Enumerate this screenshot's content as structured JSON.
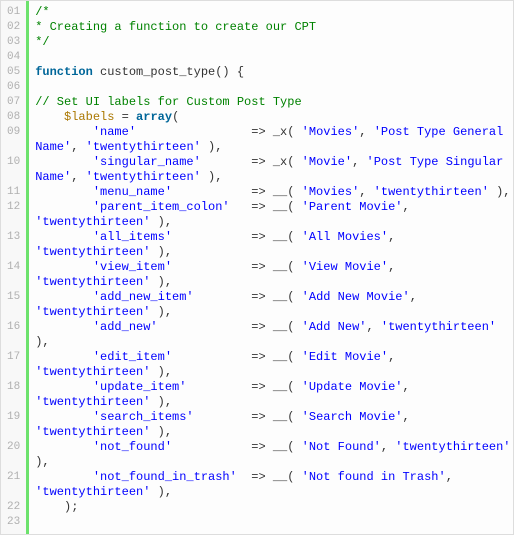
{
  "lines": [
    {
      "num": "01",
      "segs": [
        {
          "cls": "c-comment",
          "t": "/*"
        }
      ]
    },
    {
      "num": "02",
      "segs": [
        {
          "cls": "c-comment",
          "t": "* Creating a function to create our CPT"
        }
      ]
    },
    {
      "num": "03",
      "segs": [
        {
          "cls": "c-comment",
          "t": "*/"
        }
      ]
    },
    {
      "num": "04",
      "segs": [
        {
          "cls": "c-plain",
          "t": " "
        }
      ]
    },
    {
      "num": "05",
      "segs": [
        {
          "cls": "c-keyword",
          "t": "function"
        },
        {
          "cls": "c-plain",
          "t": " custom_post_type() {"
        }
      ]
    },
    {
      "num": "06",
      "segs": [
        {
          "cls": "c-plain",
          "t": " "
        }
      ]
    },
    {
      "num": "07",
      "segs": [
        {
          "cls": "c-comment",
          "t": "// Set UI labels for Custom Post Type"
        }
      ]
    },
    {
      "num": "08",
      "segs": [
        {
          "cls": "c-plain",
          "t": "    "
        },
        {
          "cls": "c-var",
          "t": "$labels"
        },
        {
          "cls": "c-plain",
          "t": " = "
        },
        {
          "cls": "c-keyword",
          "t": "array"
        },
        {
          "cls": "c-plain",
          "t": "("
        }
      ]
    },
    {
      "num": "09",
      "segs": [
        {
          "cls": "c-plain",
          "t": "        "
        },
        {
          "cls": "c-string",
          "t": "'name'"
        },
        {
          "cls": "c-plain",
          "t": "                => _x( "
        },
        {
          "cls": "c-string",
          "t": "'Movies'"
        },
        {
          "cls": "c-plain",
          "t": ", "
        },
        {
          "cls": "c-string",
          "t": "'Post Type General Name'"
        },
        {
          "cls": "c-plain",
          "t": ", "
        },
        {
          "cls": "c-string",
          "t": "'twentythirteen'"
        },
        {
          "cls": "c-plain",
          "t": " ),"
        }
      ]
    },
    {
      "num": "10",
      "segs": [
        {
          "cls": "c-plain",
          "t": "        "
        },
        {
          "cls": "c-string",
          "t": "'singular_name'"
        },
        {
          "cls": "c-plain",
          "t": "       => _x( "
        },
        {
          "cls": "c-string",
          "t": "'Movie'"
        },
        {
          "cls": "c-plain",
          "t": ", "
        },
        {
          "cls": "c-string",
          "t": "'Post Type Singular Name'"
        },
        {
          "cls": "c-plain",
          "t": ", "
        },
        {
          "cls": "c-string",
          "t": "'twentythirteen'"
        },
        {
          "cls": "c-plain",
          "t": " ),"
        }
      ]
    },
    {
      "num": "11",
      "segs": [
        {
          "cls": "c-plain",
          "t": "        "
        },
        {
          "cls": "c-string",
          "t": "'menu_name'"
        },
        {
          "cls": "c-plain",
          "t": "           => __( "
        },
        {
          "cls": "c-string",
          "t": "'Movies'"
        },
        {
          "cls": "c-plain",
          "t": ", "
        },
        {
          "cls": "c-string",
          "t": "'twentythirteen'"
        },
        {
          "cls": "c-plain",
          "t": " ),"
        }
      ]
    },
    {
      "num": "12",
      "segs": [
        {
          "cls": "c-plain",
          "t": "        "
        },
        {
          "cls": "c-string",
          "t": "'parent_item_colon'"
        },
        {
          "cls": "c-plain",
          "t": "   => __( "
        },
        {
          "cls": "c-string",
          "t": "'Parent Movie'"
        },
        {
          "cls": "c-plain",
          "t": ", "
        },
        {
          "cls": "c-string",
          "t": "'twentythirteen'"
        },
        {
          "cls": "c-plain",
          "t": " ),"
        }
      ]
    },
    {
      "num": "13",
      "segs": [
        {
          "cls": "c-plain",
          "t": "        "
        },
        {
          "cls": "c-string",
          "t": "'all_items'"
        },
        {
          "cls": "c-plain",
          "t": "           => __( "
        },
        {
          "cls": "c-string",
          "t": "'All Movies'"
        },
        {
          "cls": "c-plain",
          "t": ", "
        },
        {
          "cls": "c-string",
          "t": "'twentythirteen'"
        },
        {
          "cls": "c-plain",
          "t": " ),"
        }
      ]
    },
    {
      "num": "14",
      "segs": [
        {
          "cls": "c-plain",
          "t": "        "
        },
        {
          "cls": "c-string",
          "t": "'view_item'"
        },
        {
          "cls": "c-plain",
          "t": "           => __( "
        },
        {
          "cls": "c-string",
          "t": "'View Movie'"
        },
        {
          "cls": "c-plain",
          "t": ", "
        },
        {
          "cls": "c-string",
          "t": "'twentythirteen'"
        },
        {
          "cls": "c-plain",
          "t": " ),"
        }
      ]
    },
    {
      "num": "15",
      "segs": [
        {
          "cls": "c-plain",
          "t": "        "
        },
        {
          "cls": "c-string",
          "t": "'add_new_item'"
        },
        {
          "cls": "c-plain",
          "t": "        => __( "
        },
        {
          "cls": "c-string",
          "t": "'Add New Movie'"
        },
        {
          "cls": "c-plain",
          "t": ", "
        },
        {
          "cls": "c-string",
          "t": "'twentythirteen'"
        },
        {
          "cls": "c-plain",
          "t": " ),"
        }
      ]
    },
    {
      "num": "16",
      "segs": [
        {
          "cls": "c-plain",
          "t": "        "
        },
        {
          "cls": "c-string",
          "t": "'add_new'"
        },
        {
          "cls": "c-plain",
          "t": "             => __( "
        },
        {
          "cls": "c-string",
          "t": "'Add New'"
        },
        {
          "cls": "c-plain",
          "t": ", "
        },
        {
          "cls": "c-string",
          "t": "'twentythirteen'"
        },
        {
          "cls": "c-plain",
          "t": " ),"
        }
      ]
    },
    {
      "num": "17",
      "segs": [
        {
          "cls": "c-plain",
          "t": "        "
        },
        {
          "cls": "c-string",
          "t": "'edit_item'"
        },
        {
          "cls": "c-plain",
          "t": "           => __( "
        },
        {
          "cls": "c-string",
          "t": "'Edit Movie'"
        },
        {
          "cls": "c-plain",
          "t": ", "
        },
        {
          "cls": "c-string",
          "t": "'twentythirteen'"
        },
        {
          "cls": "c-plain",
          "t": " ),"
        }
      ]
    },
    {
      "num": "18",
      "segs": [
        {
          "cls": "c-plain",
          "t": "        "
        },
        {
          "cls": "c-string",
          "t": "'update_item'"
        },
        {
          "cls": "c-plain",
          "t": "         => __( "
        },
        {
          "cls": "c-string",
          "t": "'Update Movie'"
        },
        {
          "cls": "c-plain",
          "t": ", "
        },
        {
          "cls": "c-string",
          "t": "'twentythirteen'"
        },
        {
          "cls": "c-plain",
          "t": " ),"
        }
      ]
    },
    {
      "num": "19",
      "segs": [
        {
          "cls": "c-plain",
          "t": "        "
        },
        {
          "cls": "c-string",
          "t": "'search_items'"
        },
        {
          "cls": "c-plain",
          "t": "        => __( "
        },
        {
          "cls": "c-string",
          "t": "'Search Movie'"
        },
        {
          "cls": "c-plain",
          "t": ", "
        },
        {
          "cls": "c-string",
          "t": "'twentythirteen'"
        },
        {
          "cls": "c-plain",
          "t": " ),"
        }
      ]
    },
    {
      "num": "20",
      "segs": [
        {
          "cls": "c-plain",
          "t": "        "
        },
        {
          "cls": "c-string",
          "t": "'not_found'"
        },
        {
          "cls": "c-plain",
          "t": "           => __( "
        },
        {
          "cls": "c-string",
          "t": "'Not Found'"
        },
        {
          "cls": "c-plain",
          "t": ", "
        },
        {
          "cls": "c-string",
          "t": "'twentythirteen'"
        },
        {
          "cls": "c-plain",
          "t": " ),"
        }
      ]
    },
    {
      "num": "21",
      "segs": [
        {
          "cls": "c-plain",
          "t": "        "
        },
        {
          "cls": "c-string",
          "t": "'not_found_in_trash'"
        },
        {
          "cls": "c-plain",
          "t": "  => __( "
        },
        {
          "cls": "c-string",
          "t": "'Not found in Trash'"
        },
        {
          "cls": "c-plain",
          "t": ", "
        },
        {
          "cls": "c-string",
          "t": "'twentythirteen'"
        },
        {
          "cls": "c-plain",
          "t": " ),"
        }
      ]
    },
    {
      "num": "22",
      "segs": [
        {
          "cls": "c-plain",
          "t": "    );"
        }
      ]
    },
    {
      "num": "23",
      "segs": [
        {
          "cls": "c-plain",
          "t": "     "
        }
      ]
    }
  ]
}
